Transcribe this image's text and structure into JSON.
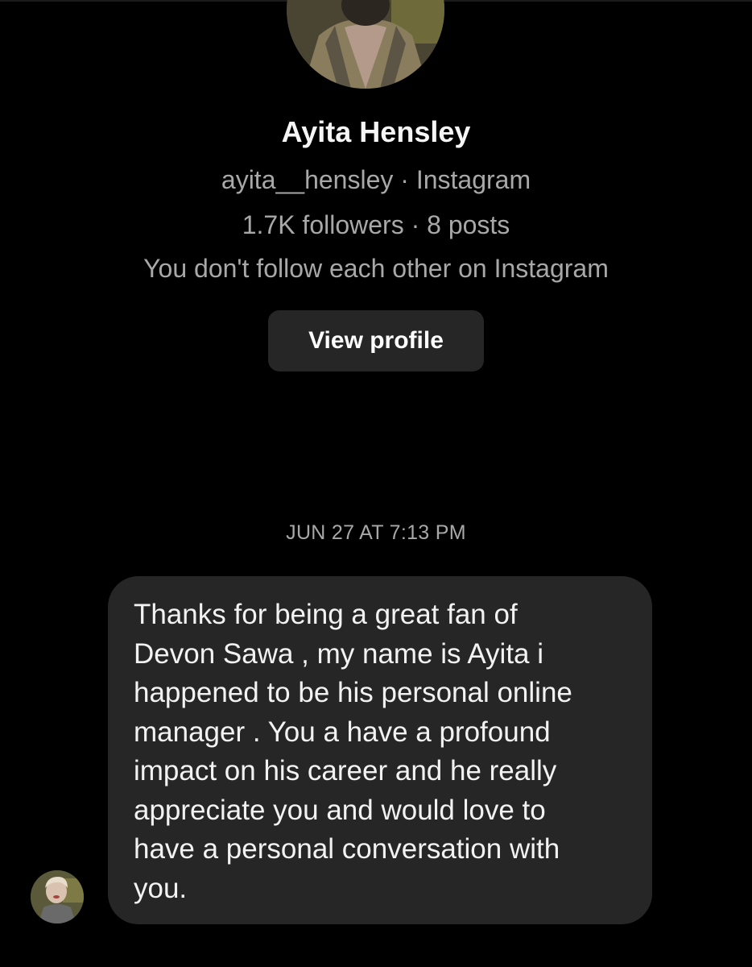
{
  "profile": {
    "name": "Ayita Hensley",
    "handle_line": "ayita__hensley · Instagram",
    "stats_line": "1.7K followers · 8 posts",
    "relationship_line": "You don't follow each other on Instagram",
    "avatar_icon": "profile-photo"
  },
  "actions": {
    "view_profile_label": "View profile"
  },
  "thread": {
    "timestamp": "JUN 27 AT 7:13 PM",
    "messages": [
      {
        "sender": "Ayita Hensley",
        "avatar_icon": "sender-profile-photo",
        "text": "Thanks for being a great fan of\nDevon Sawa , my name is Ayita i\nhappened to be his personal online\nmanager . You a have a profound\nimpact on his career and he really\nappreciate you and would love to\nhave a personal conversation with\nyou."
      }
    ]
  },
  "colors": {
    "background": "#000000",
    "bubble": "#262626",
    "button": "#262626",
    "secondary_text": "#a8a8a8",
    "primary_text": "#ffffff"
  }
}
